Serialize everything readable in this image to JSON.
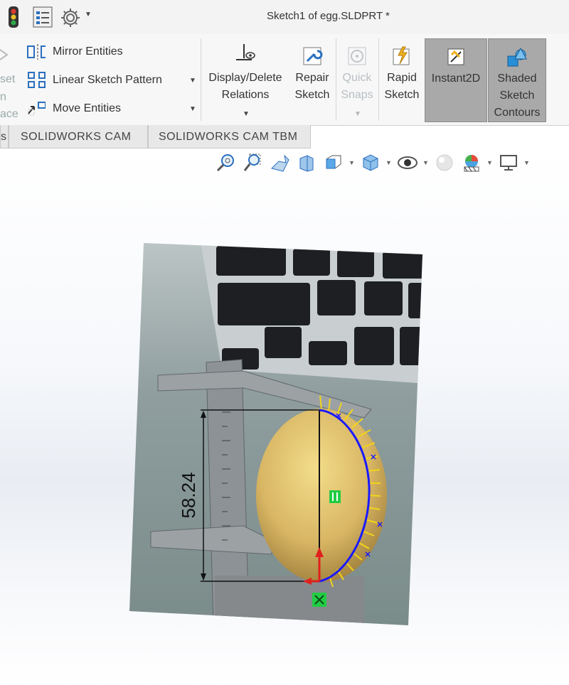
{
  "window": {
    "title": "Sketch1 of egg.SLDPRT *"
  },
  "ribbon": {
    "cut_labels": [
      "set",
      "n",
      "ace"
    ],
    "mirror_entities": "Mirror Entities",
    "linear_sketch_pattern": "Linear Sketch Pattern",
    "move_entities": "Move Entities",
    "display_delete_relations": [
      "Display/Delete",
      "Relations"
    ],
    "repair_sketch": [
      "Repair",
      "Sketch"
    ],
    "quick_snaps": [
      "Quick",
      "Snaps"
    ],
    "rapid_sketch": [
      "Rapid",
      "Sketch"
    ],
    "instant2d": "Instant2D",
    "shaded_sketch_contours": [
      "Shaded",
      "Sketch",
      "Contours"
    ]
  },
  "tabs": [
    "s",
    "SOLIDWORKS CAM",
    "SOLIDWORKS CAM TBM"
  ],
  "sketch": {
    "dimension": "58.24"
  },
  "colors": {
    "ribbon_bg": "#f7f7f7",
    "active_btn": "#a9a9a9",
    "sketch_blue": "#1a1aff",
    "relation_green": "#22cc44",
    "origin_red": "#e0201c"
  }
}
